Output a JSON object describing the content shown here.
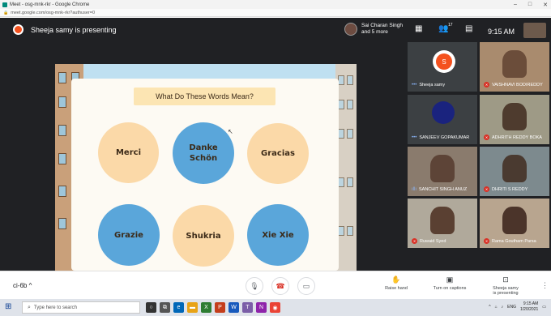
{
  "browser": {
    "tab_title": "Meet - osg-mnk-rkr - Google Chrome",
    "url": "meet.google.com/osg-mnk-rkr?authuser=0",
    "controls": [
      "–",
      "□",
      "✕"
    ]
  },
  "meet": {
    "presenter_banner": "Sheeja samy is presenting",
    "others_chip": {
      "line1": "Sai Charan Singh",
      "line2": "and 5 more"
    },
    "time": "9:15 AM",
    "top_icons": [
      "grid-icon",
      "people-icon",
      "chat-icon"
    ],
    "people_count": "17"
  },
  "slide": {
    "heading": "What Do These Words Mean?",
    "words": [
      {
        "line1": "Merci",
        "line2": "",
        "color": "#fbd9a8"
      },
      {
        "line1": "Danke",
        "line2": "Schön",
        "color": "#5aa6da"
      },
      {
        "line1": "Gracias",
        "line2": "",
        "color": "#fbd9a8"
      },
      {
        "line1": "Grazie",
        "line2": "",
        "color": "#5aa6da"
      },
      {
        "line1": "Shukria",
        "line2": "",
        "color": "#fbd9a8"
      },
      {
        "line1": "Xie Xie",
        "line2": "",
        "color": "#5aa6da"
      }
    ]
  },
  "participants": [
    {
      "name": "Sheeja samy",
      "muted": false
    },
    {
      "name": "VAISHNAVI BODIREDDY",
      "muted": true
    },
    {
      "name": "SANJEEV GOPAKUMAR",
      "muted": false
    },
    {
      "name": "ADHRITH REDDY BOKA",
      "muted": true
    },
    {
      "name": "SANCHIT SINGH ANUZ",
      "muted": false
    },
    {
      "name": "DHRITI S REDDY",
      "muted": true
    },
    {
      "name": "Ruwaid Syed",
      "muted": true
    },
    {
      "name": "Rama Goutham Parsa",
      "muted": true
    }
  ],
  "bottom": {
    "meeting_code": "ci-6b",
    "raise_hand": "Raise hand",
    "captions": "Turn on captions",
    "presenting_line1": "Sheeja samy",
    "presenting_line2": "is presenting"
  },
  "taskbar": {
    "search_placeholder": "Type here to search",
    "lang": "ENG",
    "time": "9:15 AM",
    "date": "1/20/2021"
  }
}
